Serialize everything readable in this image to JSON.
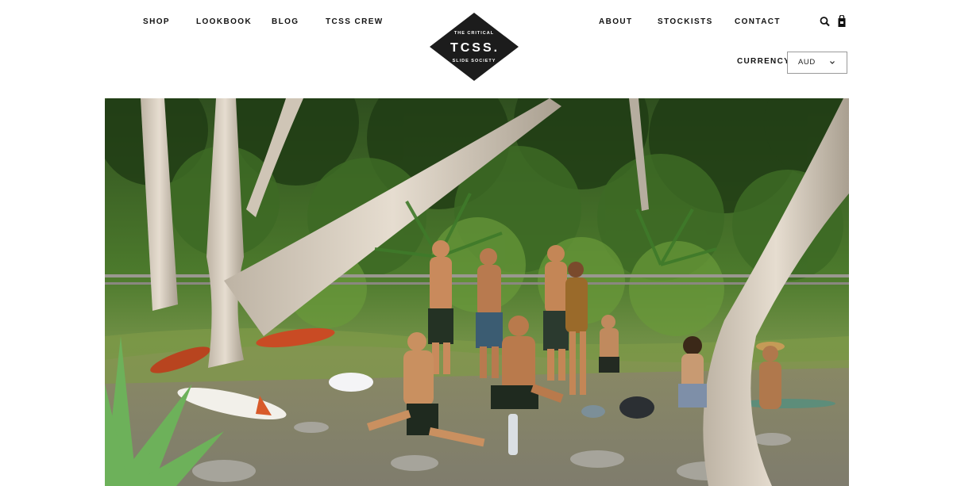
{
  "nav": {
    "left": [
      {
        "key": "shop",
        "label": "SHOP"
      },
      {
        "key": "lookbook",
        "label": "LOOKBOOK"
      },
      {
        "key": "blog",
        "label": "BLOG"
      },
      {
        "key": "tcss_crew",
        "label": "TCSS CREW"
      }
    ],
    "right": [
      {
        "key": "about",
        "label": "ABOUT"
      },
      {
        "key": "stockists",
        "label": "STOCKISTS"
      },
      {
        "key": "contact",
        "label": "CONTACT"
      }
    ]
  },
  "logo": {
    "top_text": "THE CRITICAL",
    "main_text": "TCSS.",
    "bottom_text": "SLIDE SOCIETY"
  },
  "icons": {
    "search": "search-icon",
    "cart": "shopping-bag-icon"
  },
  "currency": {
    "label": "CURRENCY:",
    "selected": "AUD"
  },
  "colors": {
    "background": "#ffffff",
    "text": "#111111",
    "logo_fill": "#1c1c1c"
  },
  "hero": {
    "alt": "Group of surfers gathered among paperbark trees and pandanus at a coastal bush clearing"
  }
}
